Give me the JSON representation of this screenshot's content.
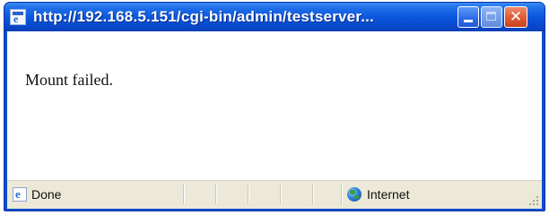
{
  "window": {
    "title": "http://192.168.5.151/cgi-bin/admin/testserver...",
    "controls": {
      "minimize": "minimize",
      "maximize": "maximize",
      "close": "✕"
    }
  },
  "content": {
    "message": "Mount failed."
  },
  "statusbar": {
    "status": "Done",
    "zone": "Internet",
    "zone_icon": "globe-icon",
    "status_icon": "ie-page-icon"
  },
  "colors": {
    "titlebar": "#0a54dc",
    "close_button": "#de5a35",
    "statusbar": "#ece9d8"
  }
}
